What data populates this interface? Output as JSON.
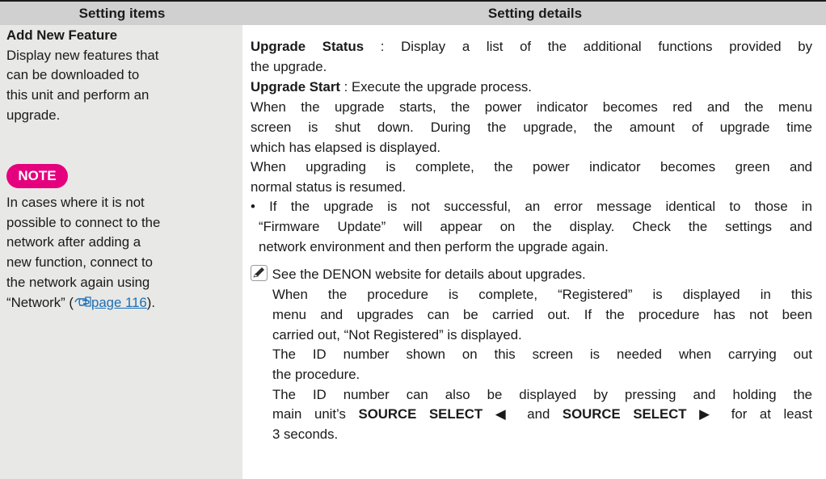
{
  "header": {
    "col1": "Setting items",
    "col2": "Setting details"
  },
  "left": {
    "title": "Add New Feature",
    "desc": [
      "Display new features that",
      "can be downloaded to",
      "this unit and perform an",
      "upgrade."
    ],
    "note_label": "NOTE",
    "note": [
      "In cases where it is not",
      "possible to connect to the",
      "network after adding a",
      "new function, connect to",
      "the network again using"
    ],
    "note_last_pre": "“Network” (",
    "note_link": "page 116",
    "note_last_post": ")."
  },
  "right": {
    "us_label": "Upgrade Status",
    "us_text": " : Display a list of the additional functions provided by",
    "us_text2": "the upgrade.",
    "ust_label": "Upgrade Start",
    "ust_text": " : Execute the upgrade process.",
    "p1": [
      "When the upgrade starts, the power indicator becomes red and the menu",
      "screen is shut down. During the upgrade, the amount of upgrade time",
      "which has elapsed is displayed."
    ],
    "p2": [
      "When upgrading is complete, the power indicator becomes green and",
      "normal status is resumed."
    ],
    "bullet": [
      "• If the upgrade is not successful, an error message identical to those in",
      "“Firmware Update” will appear on the display. Check the settings and",
      "network environment and then perform the upgrade again."
    ],
    "memo_first": "See the DENON website for details about upgrades.",
    "memo": [
      "When the procedure is complete, “Registered” is displayed in this",
      "menu and upgrades can be carried out. If the procedure has not been",
      "carried out, “Not Registered” is displayed.",
      "The ID number shown on this screen is needed when carrying out",
      "the procedure.",
      "The ID number can also be displayed by pressing and holding the"
    ],
    "src_pre": "main unit’s ",
    "src1": "SOURCE SELECT ◀",
    "src_mid": " and ",
    "src2": "SOURCE SELECT ▶",
    "src_post": " for at least",
    "last": "3 seconds."
  }
}
